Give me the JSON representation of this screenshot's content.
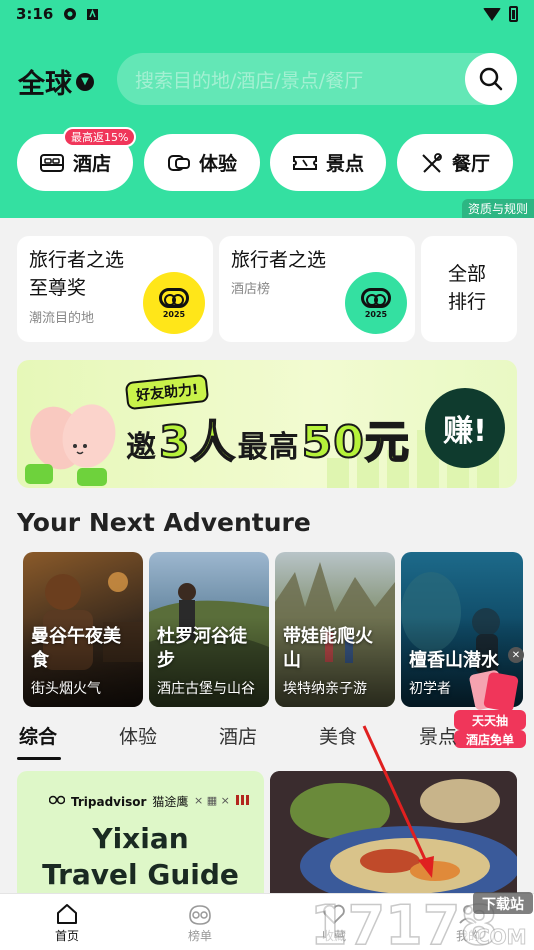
{
  "status_bar": {
    "time": "3:16"
  },
  "header": {
    "region": "全球",
    "search_placeholder": "搜索目的地/酒店/景点/餐厅",
    "categories": [
      {
        "label": "酒店",
        "icon": "bed-icon"
      },
      {
        "label": "体验",
        "icon": "ticket-icon"
      },
      {
        "label": "景点",
        "icon": "attraction-ticket-icon"
      },
      {
        "label": "餐厅",
        "icon": "utensils-icon"
      }
    ],
    "hotel_badge": "最高返15%",
    "rules_label": "资质与规则"
  },
  "awards": [
    {
      "title_line1": "旅行者之选",
      "title_line2": "至尊奖",
      "subtitle": "潮流目的地",
      "medal_year": "2025",
      "medal_color": "#ffe619"
    },
    {
      "title_line1": "旅行者之选",
      "title_line2": "",
      "subtitle": "酒店榜",
      "medal_year": "2025",
      "medal_color": "#34e0a1"
    },
    {
      "title_line1": "全部",
      "title_line2": "排行"
    }
  ],
  "banner": {
    "tag": "好友助力!",
    "text_invite": "邀",
    "text_count": "3人",
    "text_max": "最高",
    "text_amount": "50元",
    "earn_label": "赚!"
  },
  "section_title": "Your Next Adventure",
  "adventures": [
    {
      "name_line1": "曼谷午夜美",
      "name_line2": "食",
      "subtitle": "街头烟火气"
    },
    {
      "name_line1": "杜罗河谷徒",
      "name_line2": "步",
      "subtitle": "酒庄古堡与山谷"
    },
    {
      "name_line1": "带娃能爬火",
      "name_line2": "山",
      "subtitle": "埃特纳亲子游"
    },
    {
      "name_line1": "檀香山潜水",
      "name_line2": "",
      "subtitle": "初学者"
    }
  ],
  "filter_tabs": [
    "综合",
    "体验",
    "酒店",
    "美食",
    "景点"
  ],
  "float_promo": {
    "line1": "天天抽",
    "line2": "酒店免单"
  },
  "feed": {
    "card1_brand": "Tripadvisor",
    "card1_partner": "猫途鹰",
    "card1_title_line1": "Yixian",
    "card1_title_line2": "Travel Guide"
  },
  "bottom_nav": [
    {
      "label": "首页",
      "icon": "home-icon",
      "active": true
    },
    {
      "label": "榜单",
      "icon": "owl-icon",
      "active": false
    },
    {
      "label": "收藏",
      "icon": "heart-icon",
      "active": false
    },
    {
      "label": "我的",
      "icon": "profile-icon",
      "active": false
    }
  ],
  "watermark": {
    "text": "下载站",
    "number": "17178",
    "domain": "COM"
  },
  "colors": {
    "brand_green": "#34e0a1",
    "badge_red": "#f0365a",
    "dark_green": "#0f3b2e"
  }
}
